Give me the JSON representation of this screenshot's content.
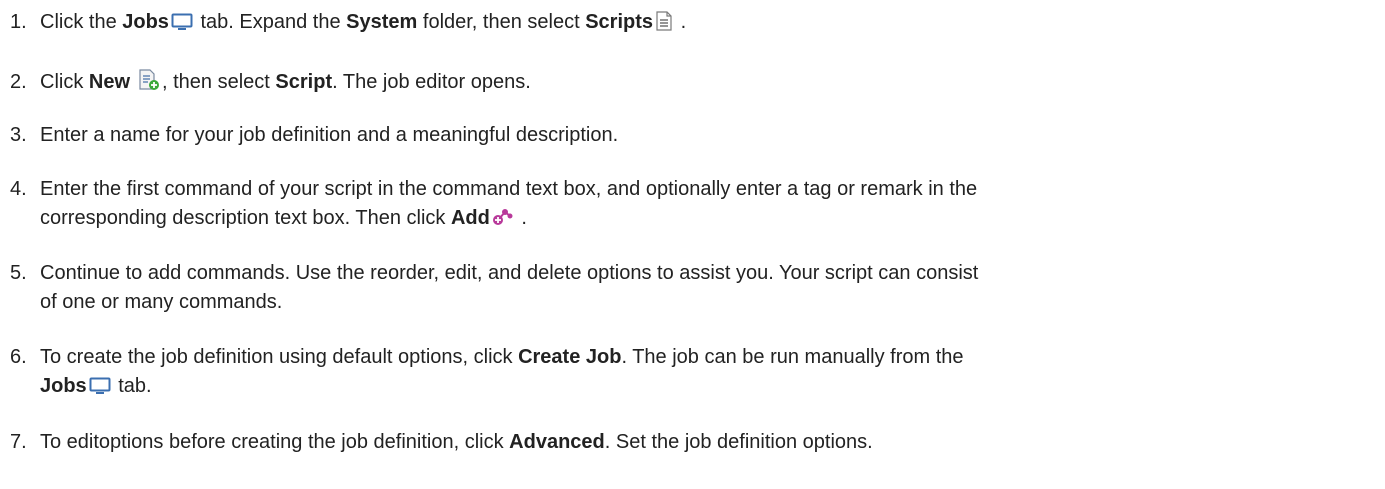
{
  "steps": [
    {
      "number": "1.",
      "t1": "Click the ",
      "b1": "Jobs",
      "t2": " tab. Expand the ",
      "b2": "System",
      "t3": " folder, then select ",
      "b3": "Scripts",
      "t4": " ."
    },
    {
      "number": "2.",
      "t1": "Click ",
      "b1": "New",
      "t2": ", then select ",
      "b2": "Script",
      "t3": ". The job editor opens."
    },
    {
      "number": "3.",
      "t1": "Enter a name for your job definition and a meaningful description."
    },
    {
      "number": "4.",
      "line1": "Enter the first command of your script in the command text box, and optionally enter a tag or remark in the",
      "t1": "corresponding description text box. Then click ",
      "b1": "Add",
      "t2": " ."
    },
    {
      "number": "5.",
      "line1": "Continue to add commands. Use the reorder, edit, and delete options to assist you. Your script can consist",
      "line2": "of one or many commands."
    },
    {
      "number": "6.",
      "t1": "To create the job definition using default options, click ",
      "b1": "Create Job",
      "t2": ". The job can be run manually from the",
      "b2": "Jobs",
      "t3": " tab."
    },
    {
      "number": "7.",
      "t1": "To editoptions before creating the job definition, click ",
      "b1": "Advanced",
      "t2": ". Set the job definition options."
    }
  ],
  "icons": {
    "jobs_tab": "monitor-icon",
    "scripts": "script-document-icon",
    "new": "new-script-icon",
    "add": "add-command-icon",
    "monitor_color": "#3b6fb0",
    "add_color": "#b8399a",
    "new_badge_color": "#3aa83a"
  }
}
